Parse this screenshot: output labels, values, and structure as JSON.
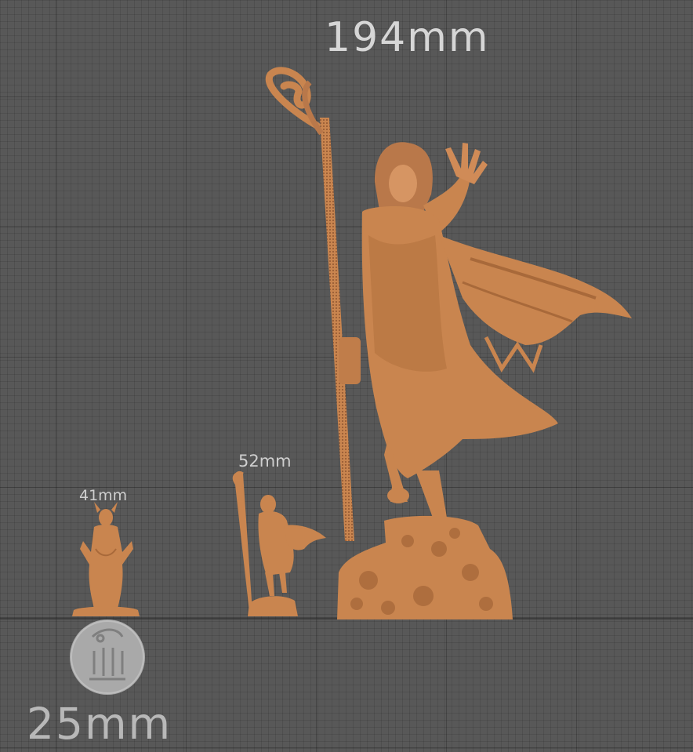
{
  "labels": {
    "large_height": "194mm",
    "medium_height": "52mm",
    "small_height": "41mm",
    "base_size": "25mm"
  },
  "colors": {
    "background": "#585858",
    "model": "#c9854f",
    "model_shadow": "#a8693a",
    "base_coin": "#a9a9a9"
  },
  "icons": {
    "logo": "logo-seal-icon"
  }
}
